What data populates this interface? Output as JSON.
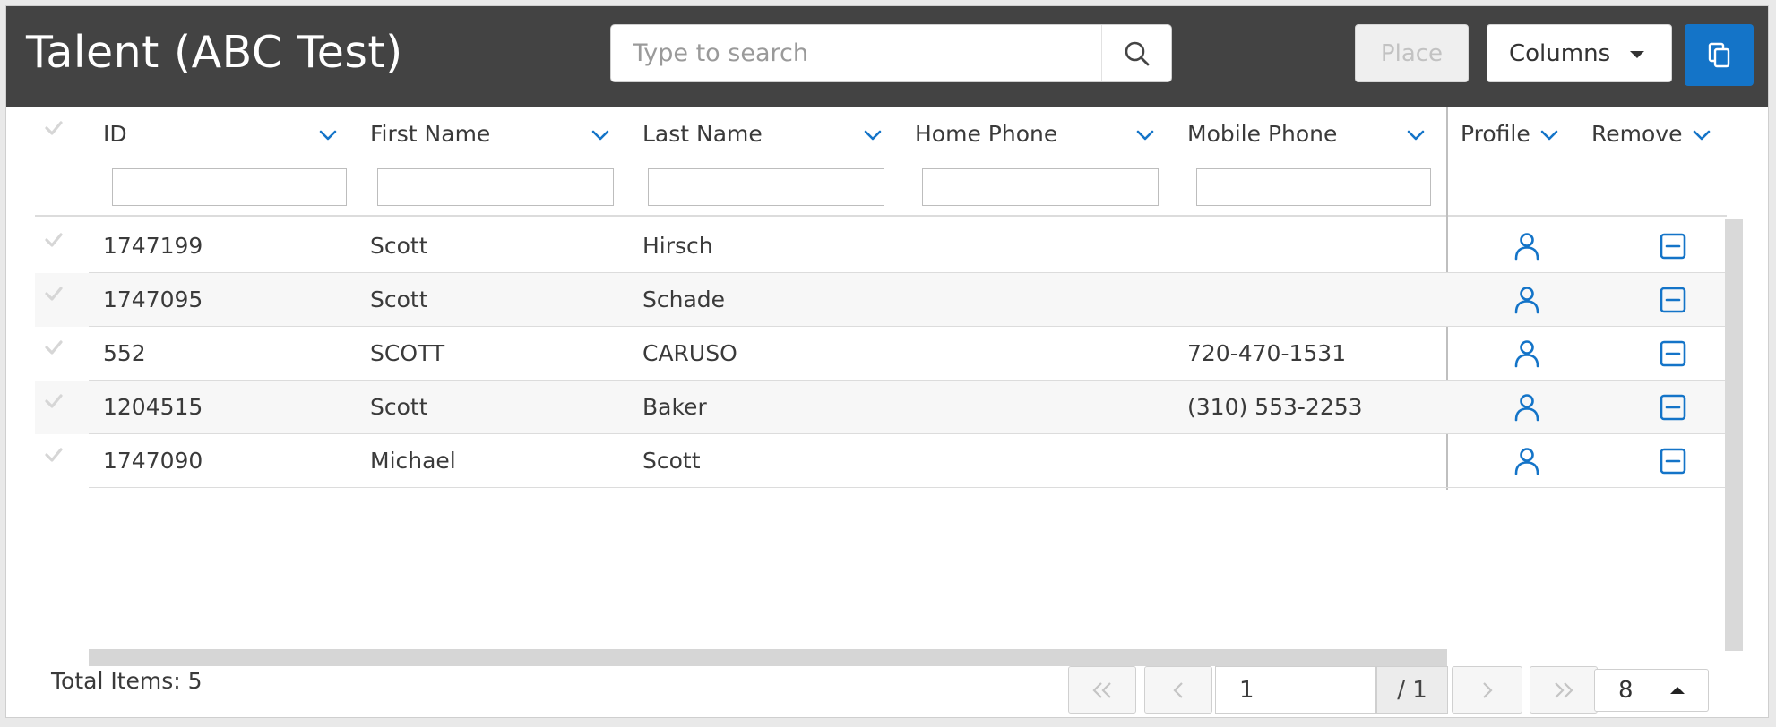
{
  "header": {
    "title": "Talent (ABC Test)",
    "search_placeholder": "Type to search",
    "place_label": "Place",
    "columns_label": "Columns",
    "icons": {
      "search": "search-icon",
      "copy": "copy-icon"
    }
  },
  "grid": {
    "columns": [
      {
        "label": "ID"
      },
      {
        "label": "First Name"
      },
      {
        "label": "Last Name"
      },
      {
        "label": "Home Phone"
      },
      {
        "label": "Mobile Phone"
      },
      {
        "label": "Profile"
      },
      {
        "label": "Remove"
      }
    ],
    "rows": [
      {
        "id": "1747199",
        "first": "Scott",
        "last": "Hirsch",
        "home": "",
        "mobile": ""
      },
      {
        "id": "1747095",
        "first": "Scott",
        "last": "Schade",
        "home": "",
        "mobile": ""
      },
      {
        "id": "552",
        "first": "SCOTT",
        "last": "CARUSO",
        "home": "",
        "mobile": "720-470-1531"
      },
      {
        "id": "1204515",
        "first": "Scott",
        "last": "Baker",
        "home": "",
        "mobile": "(310) 553-2253"
      },
      {
        "id": "1747090",
        "first": "Michael",
        "last": "Scott",
        "home": "",
        "mobile": ""
      }
    ],
    "row_icons": {
      "profile": "user-icon",
      "remove": "minus-square-icon"
    }
  },
  "footer": {
    "total_items_label": "Total Items: 5",
    "page_current": "1",
    "page_total": "/ 1",
    "page_size": "8"
  },
  "colors": {
    "header_bg": "#434343",
    "accent": "#1474c8",
    "row_stripe": "#f7f7f7"
  }
}
